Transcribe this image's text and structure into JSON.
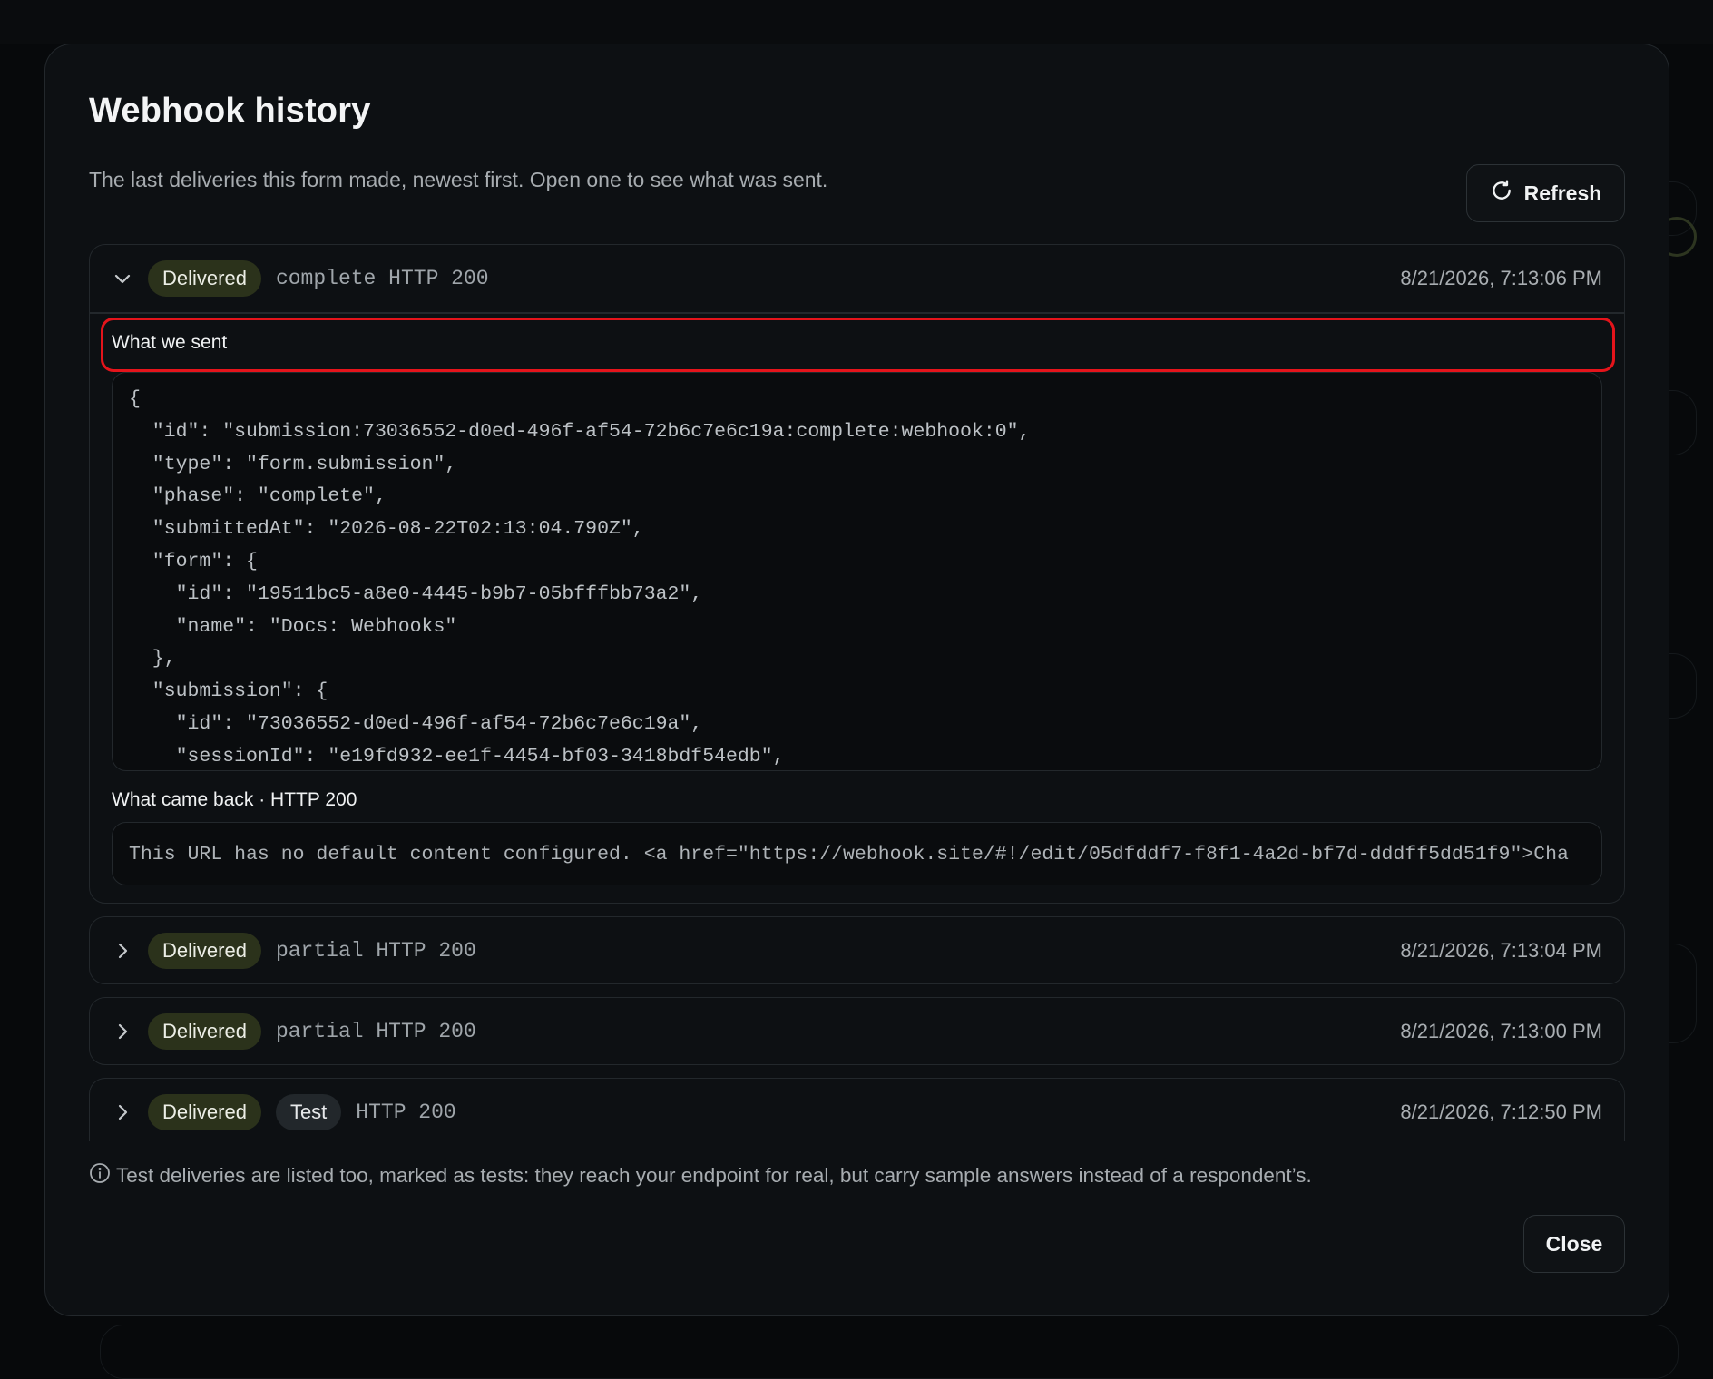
{
  "dialog": {
    "title": "Webhook history",
    "subtitle": "The last deliveries this form made, newest first. Open one to see what was sent.",
    "refresh_label": "Refresh",
    "close_label": "Close",
    "footnote": "Test deliveries are listed too, marked as tests: they reach your endpoint for real, but carry sample answers instead of a respondent’s."
  },
  "deliveries": [
    {
      "status": "Delivered",
      "meta": "complete HTTP 200",
      "timestamp": "8/21/2026, 7:13:06 PM",
      "expanded": true,
      "sent_label": "What we sent",
      "payload_lines": [
        "{",
        "  \"id\": \"submission:73036552-d0ed-496f-af54-72b6c7e6c19a:complete:webhook:0\",",
        "  \"type\": \"form.submission\",",
        "  \"phase\": \"complete\",",
        "  \"submittedAt\": \"2026-08-22T02:13:04.790Z\",",
        "  \"form\": {",
        "    \"id\": \"19511bc5-a8e0-4445-b9b7-05bfffbb73a2\",",
        "    \"name\": \"Docs: Webhooks\"",
        "  },",
        "  \"submission\": {",
        "    \"id\": \"73036552-d0ed-496f-af54-72b6c7e6c19a\",",
        "    \"sessionId\": \"e19fd932-ee1f-4454-bf03-3418bdf54edb\","
      ],
      "response_label": "What came back · HTTP 200",
      "response_body": "This URL has no default content configured. <a href=\"https://webhook.site/#!/edit/05dfddf7-f8f1-4a2d-bf7d-dddff5dd51f9\">Cha"
    },
    {
      "status": "Delivered",
      "meta": "partial HTTP 200",
      "timestamp": "8/21/2026, 7:13:04 PM",
      "expanded": false
    },
    {
      "status": "Delivered",
      "meta": "partial HTTP 200",
      "timestamp": "8/21/2026, 7:13:00 PM",
      "expanded": false
    },
    {
      "status": "Delivered",
      "test_label": "Test",
      "meta": "HTTP 200",
      "timestamp": "8/21/2026, 7:12:50 PM",
      "expanded": false
    }
  ],
  "colors": {
    "accent_delivered": "#2b321b",
    "highlight": "#e5141b",
    "background": "#0d1013"
  },
  "icons": [
    "refresh-icon",
    "chevron-down-icon",
    "chevron-right-icon",
    "info-icon"
  ]
}
